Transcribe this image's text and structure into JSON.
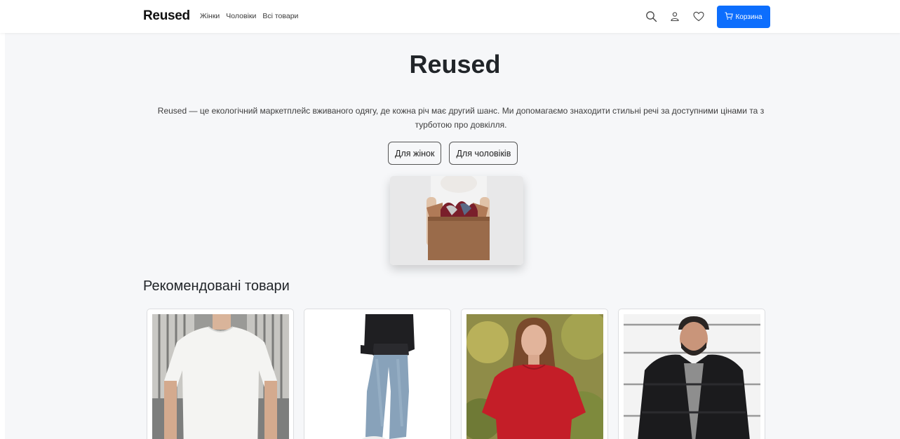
{
  "navbar": {
    "brand": "Reused",
    "links": [
      "Жінки",
      "Чоловіки",
      "Всі товари"
    ],
    "icons": [
      "search-icon",
      "user-icon",
      "heart-icon"
    ],
    "cart_label": "Корзина",
    "cart_color": "#0d6efd"
  },
  "hero": {
    "title": "Reused",
    "description": "Reused — це екологічний маркетплейс вживаного одягу, де кожна річ має другий шанс. Ми допомагаємо знаходити стильні речі за доступними цінами та з турботою про довкілля.",
    "btn_women": "Для жінок",
    "btn_men": "Для чоловіків"
  },
  "recommended": {
    "title": "Рекомендовані товари"
  },
  "colors": {
    "accent": "#0d6efd",
    "page_bg": "#f6f7f9"
  }
}
